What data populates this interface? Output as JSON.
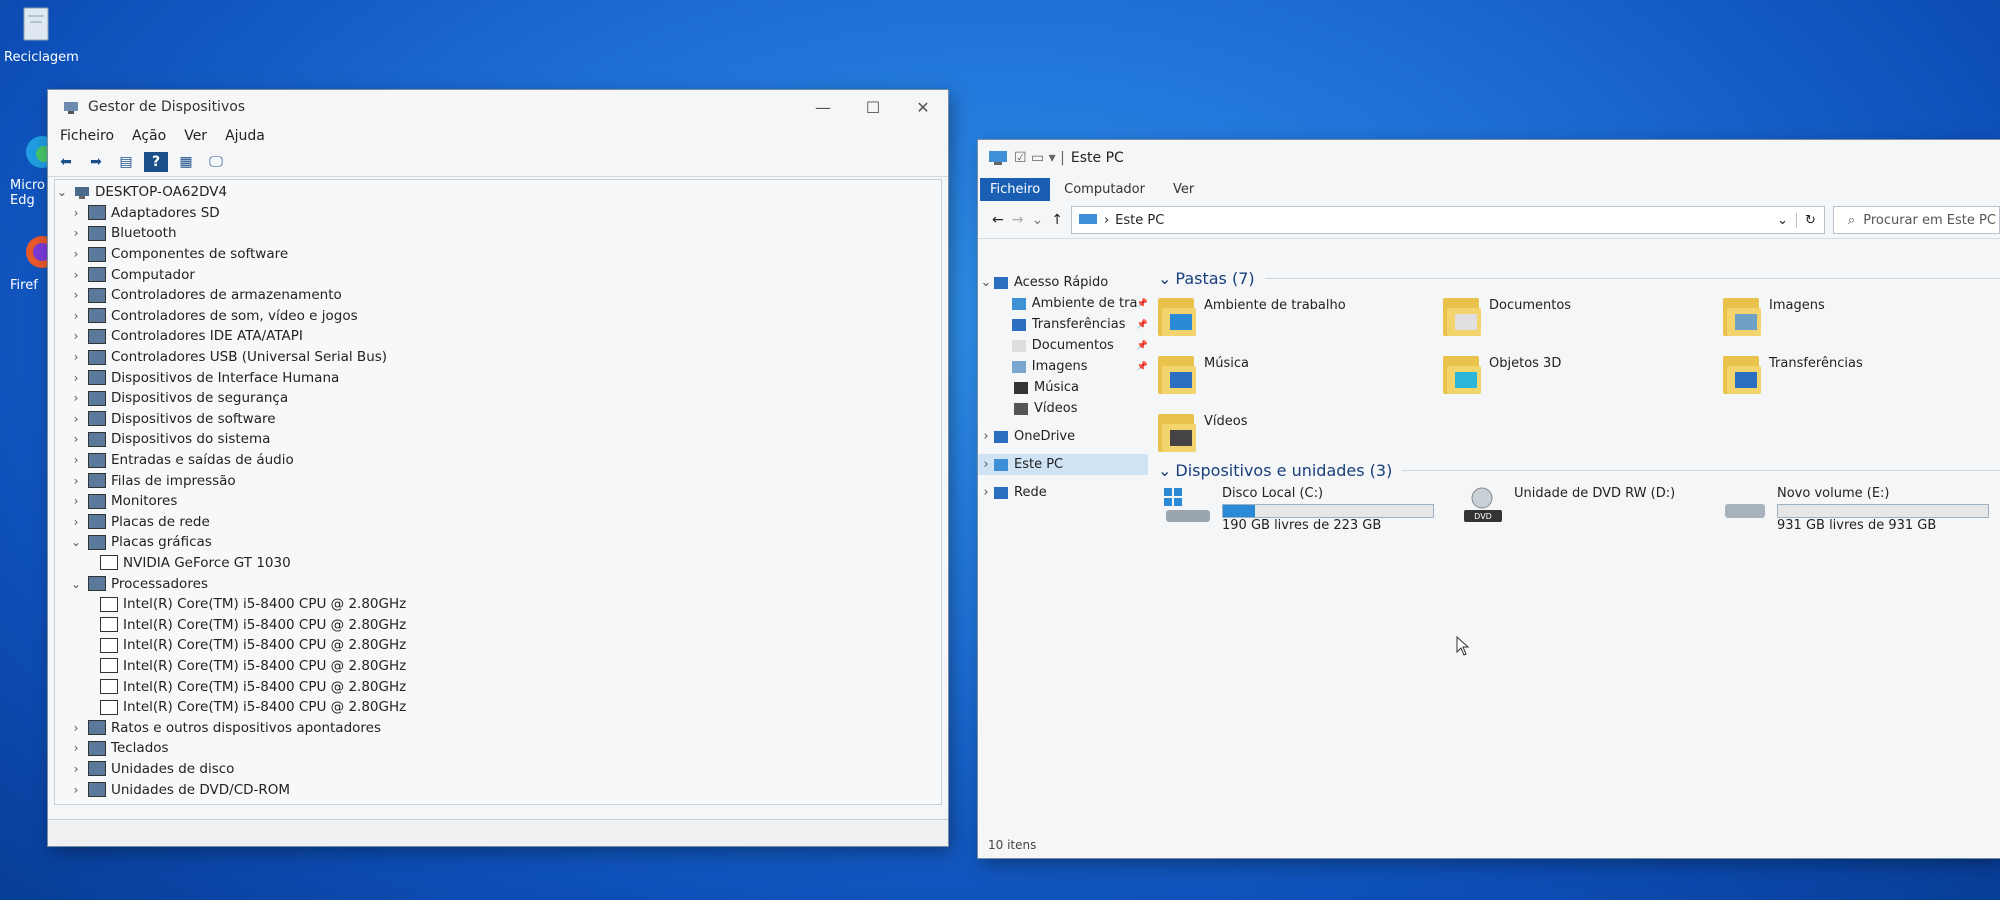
{
  "desktop": {
    "icons": [
      {
        "label": "Reciclagem"
      },
      {
        "label": "Micro Edg"
      },
      {
        "label": "Firef"
      }
    ]
  },
  "devmgr": {
    "title": "Gestor de Dispositivos",
    "menu": [
      "Ficheiro",
      "Ação",
      "Ver",
      "Ajuda"
    ],
    "root": "DESKTOP-OA62DV4",
    "nodes": [
      "Adaptadores SD",
      "Bluetooth",
      "Componentes de software",
      "Computador",
      "Controladores de armazenamento",
      "Controladores de som, vídeo e jogos",
      "Controladores IDE ATA/ATAPI",
      "Controladores USB (Universal Serial Bus)",
      "Dispositivos de Interface Humana",
      "Dispositivos de segurança",
      "Dispositivos de software",
      "Dispositivos do sistema",
      "Entradas e saídas de áudio",
      "Filas de impressão",
      "Monitores",
      "Placas de rede",
      "Placas gráficas",
      "NVIDIA GeForce GT 1030",
      "Processadores",
      "Intel(R) Core(TM) i5-8400 CPU @ 2.80GHz",
      "Intel(R) Core(TM) i5-8400 CPU @ 2.80GHz",
      "Intel(R) Core(TM) i5-8400 CPU @ 2.80GHz",
      "Intel(R) Core(TM) i5-8400 CPU @ 2.80GHz",
      "Intel(R) Core(TM) i5-8400 CPU @ 2.80GHz",
      "Intel(R) Core(TM) i5-8400 CPU @ 2.80GHz",
      "Ratos e outros dispositivos apontadores",
      "Teclados",
      "Unidades de disco",
      "Unidades de DVD/CD-ROM"
    ]
  },
  "explorer": {
    "title": "Este PC",
    "ribbon": {
      "file": "Ficheiro",
      "tabs": [
        "Computador",
        "Ver"
      ]
    },
    "address": "Este PC",
    "search_placeholder": "Procurar em Este PC",
    "nav": [
      "Acesso Rápido",
      "Ambiente de tral",
      "Transferências",
      "Documentos",
      "Imagens",
      "Música",
      "Vídeos",
      "OneDrive",
      "Este PC",
      "Rede"
    ],
    "folders_header": "Pastas (7)",
    "folders": [
      "Ambiente de trabalho",
      "Documentos",
      "Imagens",
      "Música",
      "Objetos 3D",
      "Transferências",
      "Vídeos"
    ],
    "devices_header": "Dispositivos e unidades (3)",
    "drives": [
      {
        "name": "Disco Local (C:)",
        "free": "190 GB livres de 223 GB",
        "used_fraction": 0.15
      },
      {
        "name": "Unidade de DVD RW (D:)",
        "free": ""
      },
      {
        "name": "Novo volume (E:)",
        "free": "931 GB livres de 931 GB",
        "used_fraction": 0.0
      }
    ],
    "status": "10 itens",
    "dvd_badge": "DVD"
  }
}
